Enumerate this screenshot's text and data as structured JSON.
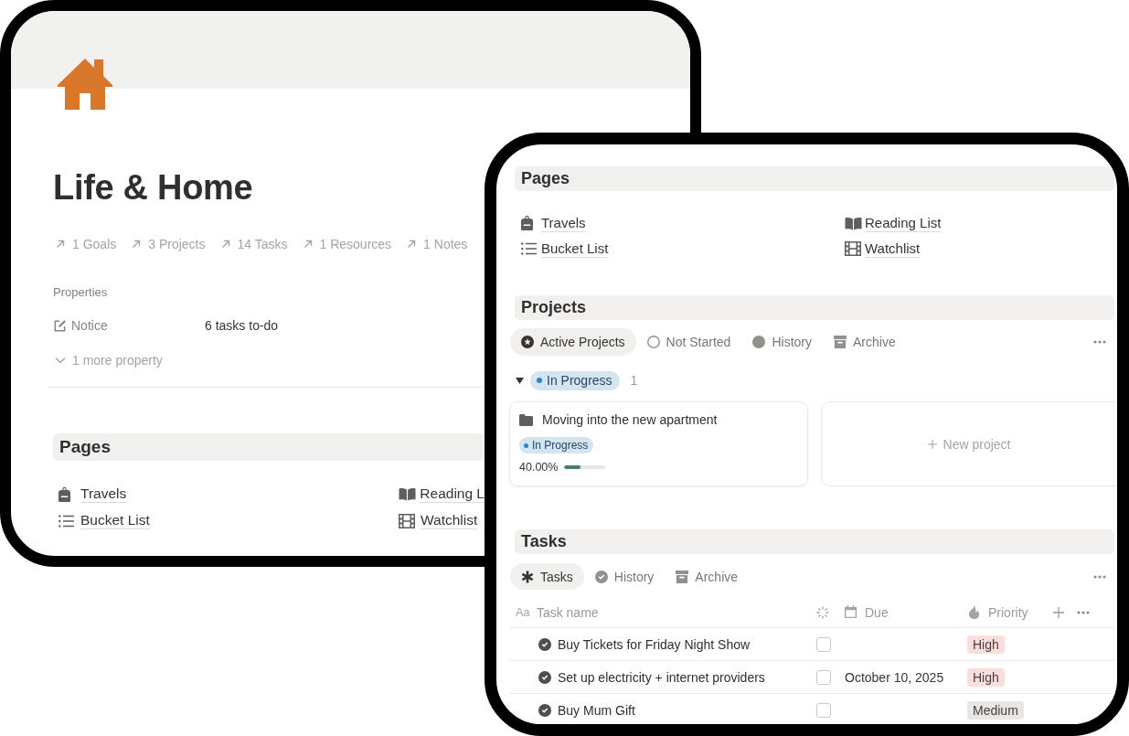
{
  "back_page": {
    "title": "Life & Home",
    "relations": [
      "1 Goals",
      "3 Projects",
      "14 Tasks",
      "1 Resources",
      "1 Notes"
    ],
    "properties": {
      "heading": "Properties",
      "items": [
        {
          "label": "Notice",
          "value": "6 tasks to-do"
        }
      ],
      "more": "1 more property"
    },
    "pages": {
      "heading": "Pages",
      "links": [
        "Travels",
        "Reading L",
        "Bucket List",
        "Watchlist"
      ]
    }
  },
  "front_page": {
    "pages": {
      "heading": "Pages",
      "links": [
        "Travels",
        "Reading List",
        "Bucket List",
        "Watchlist"
      ]
    },
    "projects": {
      "heading": "Projects",
      "tabs": [
        {
          "label": "Active Projects",
          "selected": true
        },
        {
          "label": "Not Started",
          "selected": false
        },
        {
          "label": "History",
          "selected": false
        },
        {
          "label": "Archive",
          "selected": false
        }
      ],
      "groups": [
        {
          "status": "In Progress",
          "expanded": true,
          "count": "1",
          "cards": [
            {
              "title": "Moving into the new apartment",
              "status": "In Progress",
              "progress_text": "40.00%",
              "level": 0.4
            }
          ]
        }
      ],
      "new_label": "New project"
    },
    "tasks": {
      "heading": "Tasks",
      "tabs": [
        {
          "label": "Tasks",
          "selected": true
        },
        {
          "label": "History",
          "selected": false
        },
        {
          "label": "Archive",
          "selected": false
        }
      ],
      "columns": [
        {
          "kind": "title",
          "glyph": "Aa",
          "label": "Task name"
        },
        {
          "kind": "checkbox"
        },
        {
          "kind": "date",
          "label": "Due"
        },
        {
          "kind": "select",
          "label": "Priority"
        }
      ],
      "rows": [
        {
          "name": "Buy Tickets for Friday Night Show",
          "checked": false,
          "priority": {
            "label": "High",
            "color": "#f8dfdd"
          }
        },
        {
          "name": "Set up electricity + internet providers",
          "checked": false,
          "due": "October 10, 2025",
          "priority": {
            "label": "High",
            "color": "#f8dfdd"
          }
        },
        {
          "name": "Buy Mum Gift",
          "checked": false,
          "priority": {
            "label": "Medium",
            "color": "#e8e7e5"
          }
        }
      ]
    }
  }
}
